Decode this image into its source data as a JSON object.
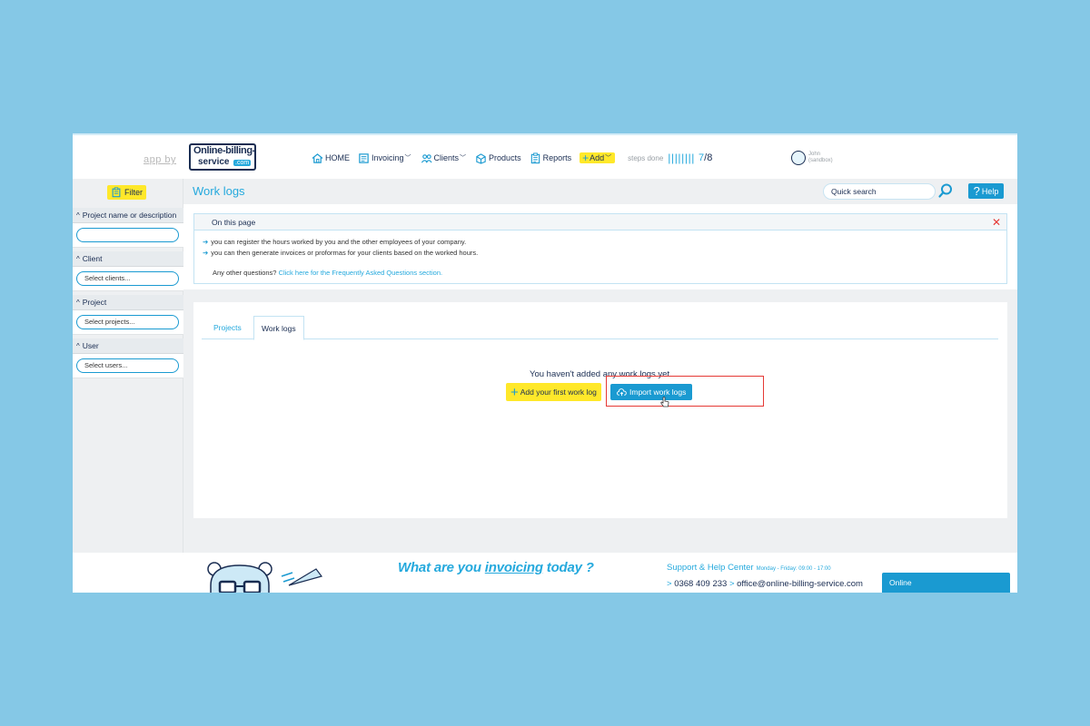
{
  "header": {
    "app_by": "app by",
    "logo_line1": "Online-billing-",
    "logo_line2": "service",
    "logo_line3": ".com",
    "nav": {
      "home": "HOME",
      "invoicing": "Invoicing",
      "clients": "Clients",
      "products": "Products",
      "reports": "Reports",
      "add": "Add"
    },
    "steps_label": "steps done",
    "steps_bars": "||||||||",
    "steps_done": "7",
    "steps_total": "/8",
    "user_name": "John",
    "user_mode": "(sandbox)"
  },
  "sidebar": {
    "filter_label": "Filter",
    "sections": [
      {
        "title": "Project name or description",
        "placeholder": ""
      },
      {
        "title": "Client",
        "placeholder": "Select clients..."
      },
      {
        "title": "Project",
        "placeholder": "Select projects..."
      },
      {
        "title": "User",
        "placeholder": "Select users..."
      }
    ]
  },
  "titlebar": {
    "title": "Work logs",
    "search_placeholder": "Quick search",
    "help_label": "Help"
  },
  "info": {
    "title": "On this page",
    "close": "✕",
    "line1": "you can register the hours worked by you and the other employees of your company.",
    "line2": "you can then generate invoices or proformas for your clients based on the worked hours.",
    "faq_prefix": "Any other questions?",
    "faq_link": "Click here for the Frequently Asked Questions section."
  },
  "main": {
    "tabs": [
      {
        "label": "Projects"
      },
      {
        "label": "Work logs"
      }
    ],
    "empty_text": "You haven't added any work logs yet.",
    "add_first_label": "Add your first work log",
    "import_label": "Import work logs"
  },
  "footer": {
    "slogan_a": "What are ",
    "slogan_b": "you ",
    "slogan_c": "invoicing",
    "slogan_d": " today ?",
    "support_title": "Support & Help Center",
    "support_hours": "Monday - Friday: 09:00 - 17:00",
    "phone": "0368 409 233",
    "email": "office@online-billing-service.com",
    "online_label": "Online"
  },
  "colors": {
    "background": "#85c8e6",
    "accent": "#25a9dd",
    "primary_button": "#1a9ad1",
    "yellow": "#ffe82a",
    "highlight": "#e53935",
    "navy": "#1a2d52"
  }
}
